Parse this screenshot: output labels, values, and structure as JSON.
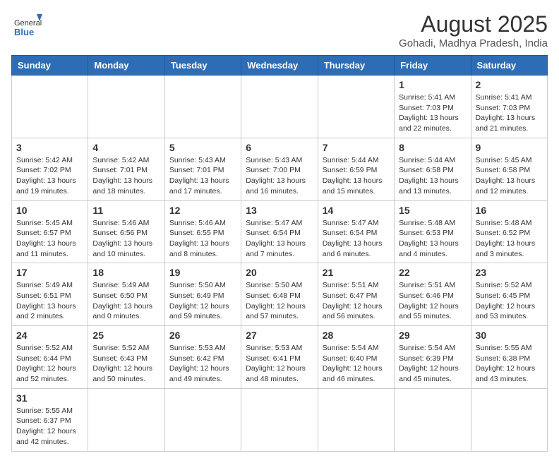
{
  "header": {
    "logo_general": "General",
    "logo_blue": "Blue",
    "month_year": "August 2025",
    "location": "Gohadi, Madhya Pradesh, India"
  },
  "days_of_week": [
    "Sunday",
    "Monday",
    "Tuesday",
    "Wednesday",
    "Thursday",
    "Friday",
    "Saturday"
  ],
  "weeks": [
    [
      {
        "day": "",
        "info": ""
      },
      {
        "day": "",
        "info": ""
      },
      {
        "day": "",
        "info": ""
      },
      {
        "day": "",
        "info": ""
      },
      {
        "day": "",
        "info": ""
      },
      {
        "day": "1",
        "info": "Sunrise: 5:41 AM\nSunset: 7:03 PM\nDaylight: 13 hours and 22 minutes."
      },
      {
        "day": "2",
        "info": "Sunrise: 5:41 AM\nSunset: 7:03 PM\nDaylight: 13 hours and 21 minutes."
      }
    ],
    [
      {
        "day": "3",
        "info": "Sunrise: 5:42 AM\nSunset: 7:02 PM\nDaylight: 13 hours and 19 minutes."
      },
      {
        "day": "4",
        "info": "Sunrise: 5:42 AM\nSunset: 7:01 PM\nDaylight: 13 hours and 18 minutes."
      },
      {
        "day": "5",
        "info": "Sunrise: 5:43 AM\nSunset: 7:01 PM\nDaylight: 13 hours and 17 minutes."
      },
      {
        "day": "6",
        "info": "Sunrise: 5:43 AM\nSunset: 7:00 PM\nDaylight: 13 hours and 16 minutes."
      },
      {
        "day": "7",
        "info": "Sunrise: 5:44 AM\nSunset: 6:59 PM\nDaylight: 13 hours and 15 minutes."
      },
      {
        "day": "8",
        "info": "Sunrise: 5:44 AM\nSunset: 6:58 PM\nDaylight: 13 hours and 13 minutes."
      },
      {
        "day": "9",
        "info": "Sunrise: 5:45 AM\nSunset: 6:58 PM\nDaylight: 13 hours and 12 minutes."
      }
    ],
    [
      {
        "day": "10",
        "info": "Sunrise: 5:45 AM\nSunset: 6:57 PM\nDaylight: 13 hours and 11 minutes."
      },
      {
        "day": "11",
        "info": "Sunrise: 5:46 AM\nSunset: 6:56 PM\nDaylight: 13 hours and 10 minutes."
      },
      {
        "day": "12",
        "info": "Sunrise: 5:46 AM\nSunset: 6:55 PM\nDaylight: 13 hours and 8 minutes."
      },
      {
        "day": "13",
        "info": "Sunrise: 5:47 AM\nSunset: 6:54 PM\nDaylight: 13 hours and 7 minutes."
      },
      {
        "day": "14",
        "info": "Sunrise: 5:47 AM\nSunset: 6:54 PM\nDaylight: 13 hours and 6 minutes."
      },
      {
        "day": "15",
        "info": "Sunrise: 5:48 AM\nSunset: 6:53 PM\nDaylight: 13 hours and 4 minutes."
      },
      {
        "day": "16",
        "info": "Sunrise: 5:48 AM\nSunset: 6:52 PM\nDaylight: 13 hours and 3 minutes."
      }
    ],
    [
      {
        "day": "17",
        "info": "Sunrise: 5:49 AM\nSunset: 6:51 PM\nDaylight: 13 hours and 2 minutes."
      },
      {
        "day": "18",
        "info": "Sunrise: 5:49 AM\nSunset: 6:50 PM\nDaylight: 13 hours and 0 minutes."
      },
      {
        "day": "19",
        "info": "Sunrise: 5:50 AM\nSunset: 6:49 PM\nDaylight: 12 hours and 59 minutes."
      },
      {
        "day": "20",
        "info": "Sunrise: 5:50 AM\nSunset: 6:48 PM\nDaylight: 12 hours and 57 minutes."
      },
      {
        "day": "21",
        "info": "Sunrise: 5:51 AM\nSunset: 6:47 PM\nDaylight: 12 hours and 56 minutes."
      },
      {
        "day": "22",
        "info": "Sunrise: 5:51 AM\nSunset: 6:46 PM\nDaylight: 12 hours and 55 minutes."
      },
      {
        "day": "23",
        "info": "Sunrise: 5:52 AM\nSunset: 6:45 PM\nDaylight: 12 hours and 53 minutes."
      }
    ],
    [
      {
        "day": "24",
        "info": "Sunrise: 5:52 AM\nSunset: 6:44 PM\nDaylight: 12 hours and 52 minutes."
      },
      {
        "day": "25",
        "info": "Sunrise: 5:52 AM\nSunset: 6:43 PM\nDaylight: 12 hours and 50 minutes."
      },
      {
        "day": "26",
        "info": "Sunrise: 5:53 AM\nSunset: 6:42 PM\nDaylight: 12 hours and 49 minutes."
      },
      {
        "day": "27",
        "info": "Sunrise: 5:53 AM\nSunset: 6:41 PM\nDaylight: 12 hours and 48 minutes."
      },
      {
        "day": "28",
        "info": "Sunrise: 5:54 AM\nSunset: 6:40 PM\nDaylight: 12 hours and 46 minutes."
      },
      {
        "day": "29",
        "info": "Sunrise: 5:54 AM\nSunset: 6:39 PM\nDaylight: 12 hours and 45 minutes."
      },
      {
        "day": "30",
        "info": "Sunrise: 5:55 AM\nSunset: 6:38 PM\nDaylight: 12 hours and 43 minutes."
      }
    ],
    [
      {
        "day": "31",
        "info": "Sunrise: 5:55 AM\nSunset: 6:37 PM\nDaylight: 12 hours and 42 minutes."
      },
      {
        "day": "",
        "info": ""
      },
      {
        "day": "",
        "info": ""
      },
      {
        "day": "",
        "info": ""
      },
      {
        "day": "",
        "info": ""
      },
      {
        "day": "",
        "info": ""
      },
      {
        "day": "",
        "info": ""
      }
    ]
  ]
}
